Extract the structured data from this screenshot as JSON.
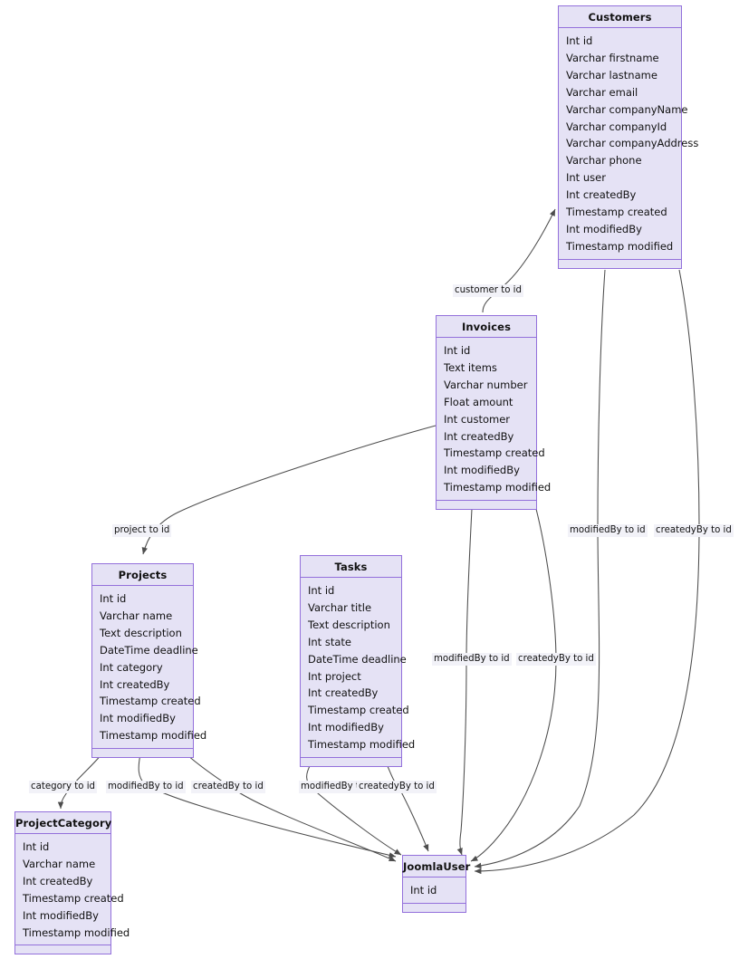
{
  "diagram": {
    "type": "uml-class-diagram",
    "title": "",
    "theme": {
      "box_fill": "#e5e2f5",
      "box_border": "#9370db",
      "edge_color": "#4d4d4d",
      "label_bg": "#f2f2f8",
      "text_color": "#111111",
      "background": "#ffffff"
    }
  },
  "entities": [
    {
      "id": "customers",
      "name": "Customers",
      "attributes": [
        "Int id",
        "Varchar firstname",
        "Varchar lastname",
        "Varchar email",
        "Varchar companyName",
        "Varchar companyId",
        "Varchar companyAddress",
        "Varchar phone",
        "Int user",
        "Int createdBy",
        "Timestamp created",
        "Int modifiedBy",
        "Timestamp modified"
      ]
    },
    {
      "id": "invoices",
      "name": "Invoices",
      "attributes": [
        "Int id",
        "Text items",
        "Varchar number",
        "Float amount",
        "Int customer",
        "Int createdBy",
        "Timestamp created",
        "Int modifiedBy",
        "Timestamp modified"
      ]
    },
    {
      "id": "projects",
      "name": "Projects",
      "attributes": [
        "Int id",
        "Varchar name",
        "Text description",
        "DateTime deadline",
        "Int category",
        "Int createdBy",
        "Timestamp created",
        "Int modifiedBy",
        "Timestamp modified"
      ]
    },
    {
      "id": "tasks",
      "name": "Tasks",
      "attributes": [
        "Int id",
        "Varchar title",
        "Text description",
        "Int state",
        "DateTime deadline",
        "Int project",
        "Int createdBy",
        "Timestamp created",
        "Int modifiedBy",
        "Timestamp modified"
      ]
    },
    {
      "id": "projectcategory",
      "name": "ProjectCategory",
      "attributes": [
        "Int id",
        "Varchar name",
        "Int createdBy",
        "Timestamp created",
        "Int modifiedBy",
        "Timestamp modified"
      ]
    },
    {
      "id": "joomlauser",
      "name": "JoomlaUser",
      "attributes": [
        "Int id"
      ]
    }
  ],
  "relationships": [
    {
      "id": "r1",
      "from": "invoices",
      "to": "customers",
      "label": "customer to id"
    },
    {
      "id": "r2",
      "from": "invoices",
      "to": "projects",
      "label": "project to id"
    },
    {
      "id": "r3",
      "from": "projects",
      "to": "projectcategory",
      "label": "category to id"
    },
    {
      "id": "r4",
      "from": "projects",
      "to": "joomlauser",
      "label": "modifiedBy to id"
    },
    {
      "id": "r5",
      "from": "projects",
      "to": "joomlauser",
      "label": "createdBy to id"
    },
    {
      "id": "r6",
      "from": "tasks",
      "to": "joomlauser",
      "label": "modifiedBy to id"
    },
    {
      "id": "r7",
      "from": "tasks",
      "to": "joomlauser",
      "label": "createdyBy to id"
    },
    {
      "id": "r8",
      "from": "invoices",
      "to": "joomlauser",
      "label": "modifiedBy to id"
    },
    {
      "id": "r9",
      "from": "invoices",
      "to": "joomlauser",
      "label": "createdyBy to id"
    },
    {
      "id": "r10",
      "from": "customers",
      "to": "joomlauser",
      "label": "modifiedBy to id"
    },
    {
      "id": "r11",
      "from": "customers",
      "to": "joomlauser",
      "label": "createdyBy to id"
    }
  ]
}
